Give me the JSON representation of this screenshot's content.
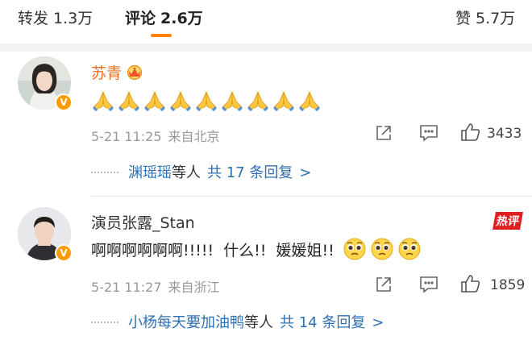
{
  "tabs": {
    "repost": {
      "label": "转发",
      "count": "1.3万"
    },
    "comment": {
      "label": "评论",
      "count": "2.6万"
    },
    "like": {
      "label": "赞",
      "count": "5.7万"
    }
  },
  "colors": {
    "accent": "#ff8200",
    "link": "#2d6fb3",
    "name_vip": "#f26f21",
    "hot": "#e02020"
  },
  "comments": [
    {
      "username": "苏青",
      "badge_icon": "crown-icon",
      "text_emoji": "folded-hands-emoji",
      "emoji_count": 9,
      "time": "5-21 11:25",
      "source": "来自北京",
      "likes": "3433",
      "reply_users": "渊瑶瑶",
      "reply_mid": "等人",
      "reply_count": "共 17 条回复",
      "reply_arrow": ">"
    },
    {
      "username": "演员张露_Stan",
      "hot_label": "热评",
      "text": "啊啊啊啊啊啊!!!!!  什么!!  媛媛姐!!",
      "trailing_emoji": "pleading-face-emoji",
      "emoji_count": 3,
      "time": "5-21 11:27",
      "source": "来自浙江",
      "likes": "1859",
      "reply_users": "小杨每天要加油鸭",
      "reply_mid": "等人",
      "reply_count": "共 14 条回复",
      "reply_arrow": ">"
    }
  ]
}
